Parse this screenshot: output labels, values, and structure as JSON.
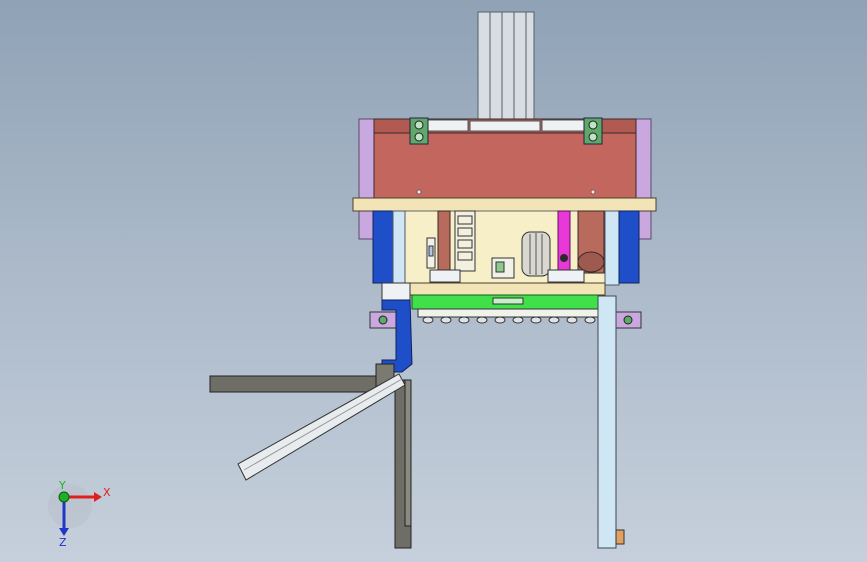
{
  "viewport": {
    "background_top": "#8fa2b6",
    "background_bottom": "#c6d0dc"
  },
  "triad": {
    "x_label": "X",
    "y_label": "Y",
    "z_label": "Z",
    "x_color": "#e0201f",
    "y_color": "#1fb02a",
    "z_color": "#2036c8"
  },
  "colors": {
    "red_plate": "#c2665e",
    "violet_side": "#c9a8e0",
    "cream": "#f2e4b6",
    "blue_column": "#1f4fc8",
    "light_blue": "#cfe6f4",
    "green_bar": "#3fe04a",
    "magenta_slide": "#e838d8",
    "dark_gray": "#6e6e66",
    "light_gray": "#e9ecef",
    "brown_roller": "#b86b5c"
  }
}
